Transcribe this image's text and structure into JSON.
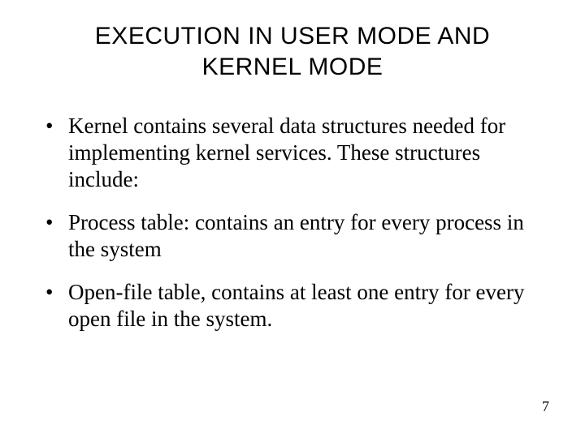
{
  "title": "EXECUTION IN USER MODE AND KERNEL MODE",
  "bullets": [
    "Kernel contains several data structures needed for implementing kernel services. These structures include:",
    "Process table: contains an entry for every process in the system",
    "Open-file table, contains at least one entry for every open file in the system."
  ],
  "page_number": "7"
}
